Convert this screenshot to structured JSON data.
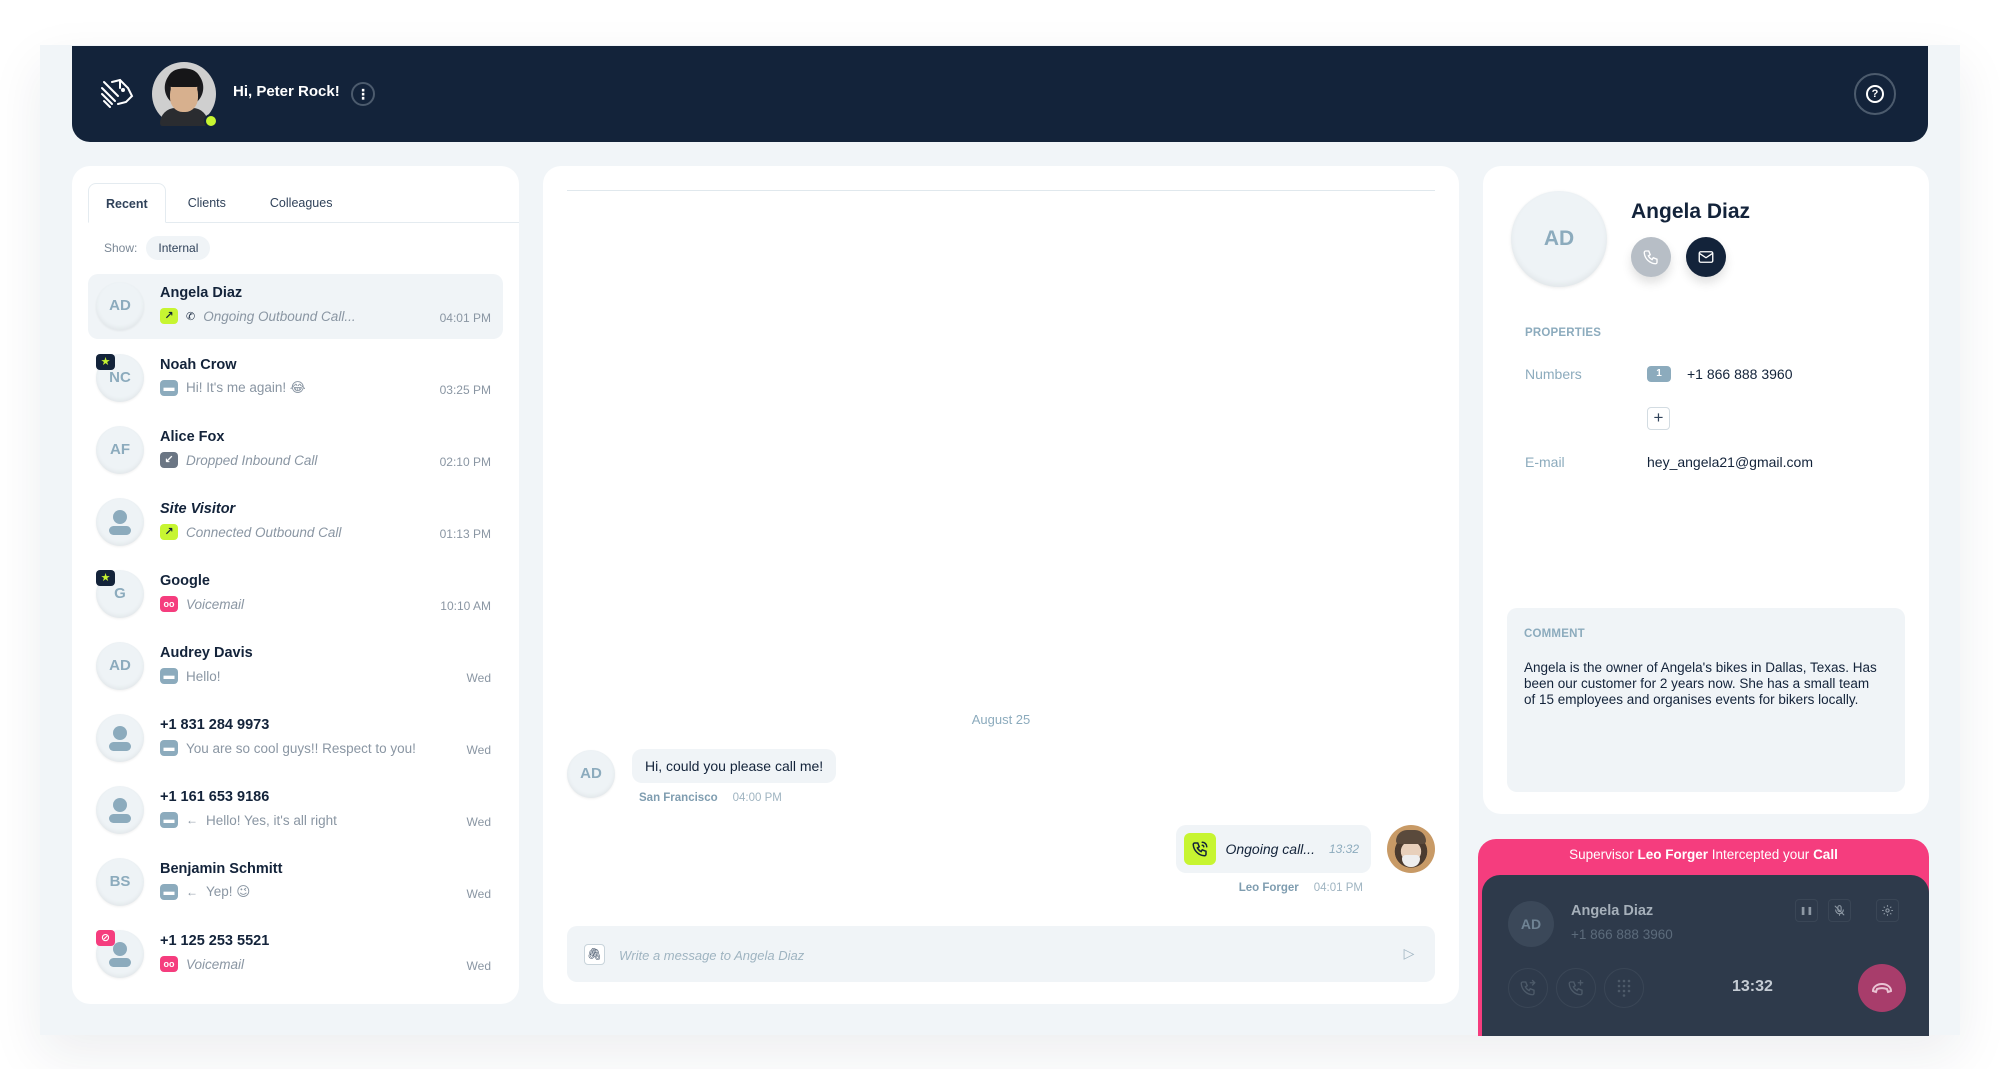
{
  "header": {
    "greeting": "Hi, Peter Rock!",
    "more_icon": "⋮",
    "help_icon": "?"
  },
  "contacts_panel": {
    "tabs": [
      {
        "label": "Recent",
        "active": true
      },
      {
        "label": "Clients",
        "active": false
      },
      {
        "label": "Colleagues",
        "active": false
      }
    ],
    "show_label": "Show:",
    "filter_chip": "Internal",
    "contacts": [
      {
        "initials": "AD",
        "name": "Angela Diaz",
        "status_icon": "outbound-call",
        "status_glyph": "↗",
        "extra_icon": "✆",
        "subtitle": "Ongoing Outbound Call...",
        "time": "04:01 PM",
        "selected": true
      },
      {
        "initials": "NC",
        "name": "Noah Crow",
        "badge": "star",
        "status_icon": "message",
        "subtitle": "Hi! It's me again! 😂",
        "time": "03:25 PM"
      },
      {
        "initials": "AF",
        "name": "Alice Fox",
        "status_icon": "inbound-call",
        "status_glyph": "↙",
        "subtitle": "Dropped Inbound Call",
        "time": "02:10 PM"
      },
      {
        "initials": "",
        "name": "Site Visitor",
        "status_icon": "outbound-call",
        "status_glyph": "↗",
        "subtitle": "Connected Outbound Call",
        "time": "01:13 PM"
      },
      {
        "initials": "G",
        "name": "Google",
        "badge": "star",
        "status_icon": "voicemail",
        "status_glyph": "oo",
        "subtitle": "Voicemail",
        "time": "10:10 AM"
      },
      {
        "initials": "AD",
        "name": "Audrey Davis",
        "status_icon": "message",
        "subtitle": "Hello!",
        "time": "Wed"
      },
      {
        "initials": "",
        "name": "+1 831 284 9973",
        "status_icon": "message",
        "subtitle": "You are so cool guys!! Respect to you!",
        "time": "Wed"
      },
      {
        "initials": "",
        "name": "+1 161 653 9186",
        "status_icon": "message",
        "reply_arrow": "←",
        "subtitle": "Hello! Yes, it's all right",
        "time": "Wed"
      },
      {
        "initials": "BS",
        "name": "Benjamin Schmitt",
        "status_icon": "message",
        "reply_arrow": "←",
        "subtitle": "Yep! 😉",
        "time": "Wed"
      },
      {
        "initials": "",
        "name": "+1 125 253 5521",
        "badge": "blocked",
        "status_icon": "voicemail",
        "status_glyph": "oo",
        "subtitle": "Voicemail",
        "time": "Wed"
      }
    ]
  },
  "chat": {
    "date_separator": "August 25",
    "incoming": {
      "avatar_initials": "AD",
      "text": "Hi, could you please call me!",
      "location": "San Francisco",
      "time": "04:00 PM"
    },
    "outgoing": {
      "label": "Ongoing call...",
      "duration": "13:32",
      "sender": "Leo Forger",
      "time": "04:01 PM"
    },
    "composer": {
      "placeholder": "Write a message to Angela Diaz",
      "value": "",
      "attach_icon": "🖇",
      "send_icon": "▷"
    }
  },
  "profile": {
    "initials": "AD",
    "name": "Angela Diaz",
    "properties_label": "PROPERTIES",
    "numbers_label": "Numbers",
    "number_index": "1",
    "number": "+1 866 888 3960",
    "add_label": "+",
    "email_label": "E-mail",
    "email": "hey_angela21@gmail.com",
    "comment_label": "COMMENT",
    "comment": "Angela is the owner of Angela's bikes in Dallas, Texas. Has been our customer for 2 years now. She has a small team of 15 employees and organises events for bikers locally."
  },
  "call_widget": {
    "banner_prefix": "Supervisor",
    "banner_name": "Leo Forger",
    "banner_middle": "Intercepted your",
    "banner_end": "Call",
    "initials": "AD",
    "name": "Angela Diaz",
    "number": "+1 866 888 3960",
    "timer": "13:32",
    "pause_icon": "❚❚",
    "colors": {
      "banner": "#f53d7e",
      "body": "#2e3a4b",
      "hangup": "#a83d6b"
    }
  },
  "colors": {
    "navy": "#13233a",
    "accent_lime": "#c7f531",
    "accent_pink": "#f53d7e",
    "muted_blue": "#8cabbd"
  }
}
